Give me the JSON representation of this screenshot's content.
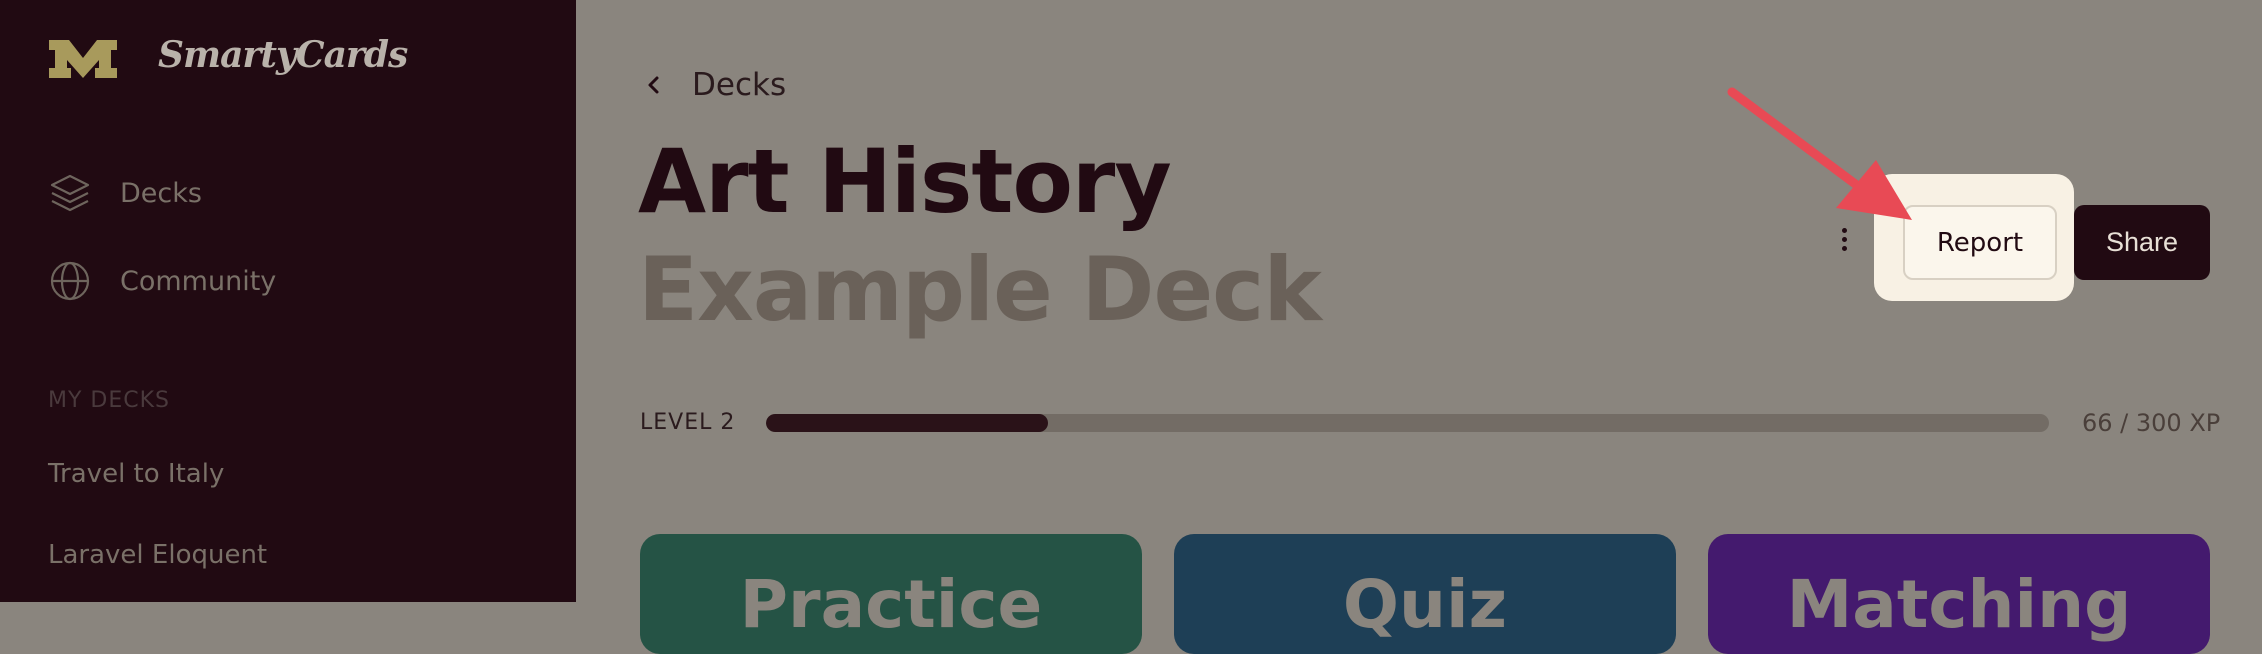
{
  "app": {
    "name": "SmartyCards",
    "logo_letter": "M"
  },
  "sidebar": {
    "nav": [
      {
        "label": "Decks",
        "icon": "layers-icon"
      },
      {
        "label": "Community",
        "icon": "globe-icon"
      }
    ],
    "section_title": "MY DECKS",
    "decks": [
      "Travel to Italy",
      "Laravel Eloquent"
    ]
  },
  "main": {
    "breadcrumb": "Decks",
    "title_line1": "Art History",
    "title_line2": "Example Deck",
    "actions": {
      "report_label": "Report",
      "share_label": "Share"
    },
    "level": {
      "label": "LEVEL 2",
      "xp_text": "66 / 300 XP",
      "xp_current": 66,
      "xp_max": 300
    },
    "modes": [
      "Practice",
      "Quiz",
      "Matching"
    ]
  },
  "colors": {
    "sidebar_bg": "#210a12",
    "overlay_bg": "#8a857e",
    "highlight": "#f8f1e4",
    "arrow": "#e84a55",
    "practice": "#255345",
    "quiz": "#1e3f56",
    "matching": "#441a6e"
  }
}
